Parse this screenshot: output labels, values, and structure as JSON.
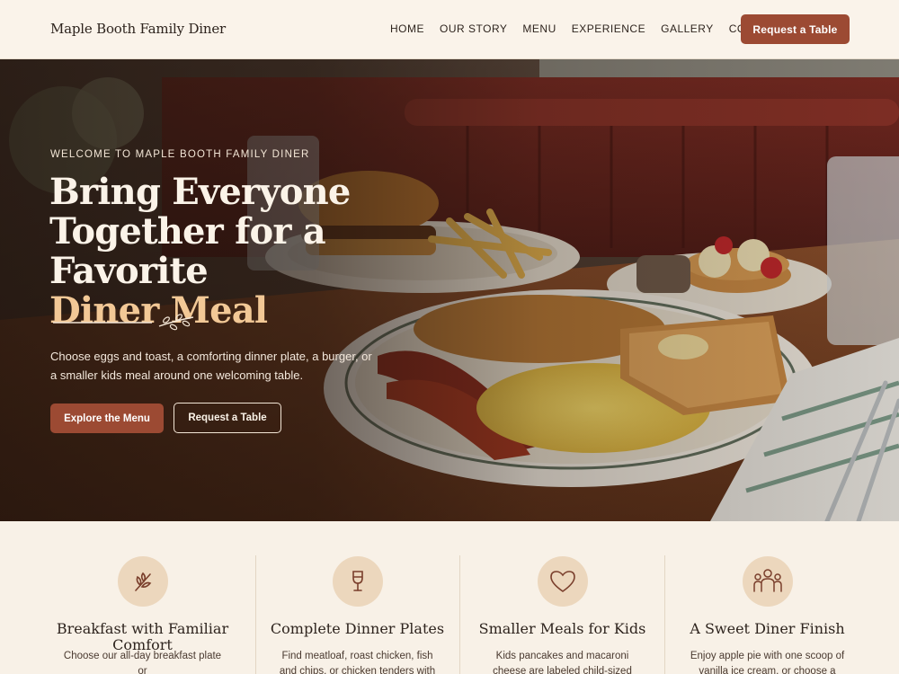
{
  "brand": "Maple Booth Family Diner",
  "nav": {
    "links": [
      "HOME",
      "OUR STORY",
      "MENU",
      "EXPERIENCE",
      "GALLERY",
      "CONTACT"
    ],
    "cta": "Request a Table"
  },
  "hero": {
    "eyebrow": "WELCOME TO MAPLE BOOTH FAMILY DINER",
    "headline_line1": "Bring Everyone",
    "headline_line2": "Together for a Favorite",
    "headline_accent": "Diner Meal",
    "lede": "Choose eggs and toast, a comforting dinner plate, a burger, or a smaller kids meal around one welcoming table.",
    "primary_button": "Explore the Menu",
    "secondary_button": "Request a Table"
  },
  "features": [
    {
      "icon": "leaf-icon",
      "title": "Breakfast with Familiar Comfort",
      "text": "Choose our all-day breakfast plate or"
    },
    {
      "icon": "wine-glass-icon",
      "title": "Complete Dinner Plates",
      "text": "Find meatloaf, roast chicken, fish and chips, or chicken tenders with"
    },
    {
      "icon": "heart-icon",
      "title": "Smaller Meals for Kids",
      "text": "Kids pancakes and macaroni cheese are labeled child-sized"
    },
    {
      "icon": "family-icon",
      "title": "A Sweet Diner Finish",
      "text": "Enjoy apple pie with one scoop of vanilla ice cream, or choose a"
    }
  ],
  "colors": {
    "accent": "#9c4a33",
    "headline_accent": "#f2c896",
    "icon_circle": "#ecd7bd",
    "background": "#f8f1e7"
  }
}
